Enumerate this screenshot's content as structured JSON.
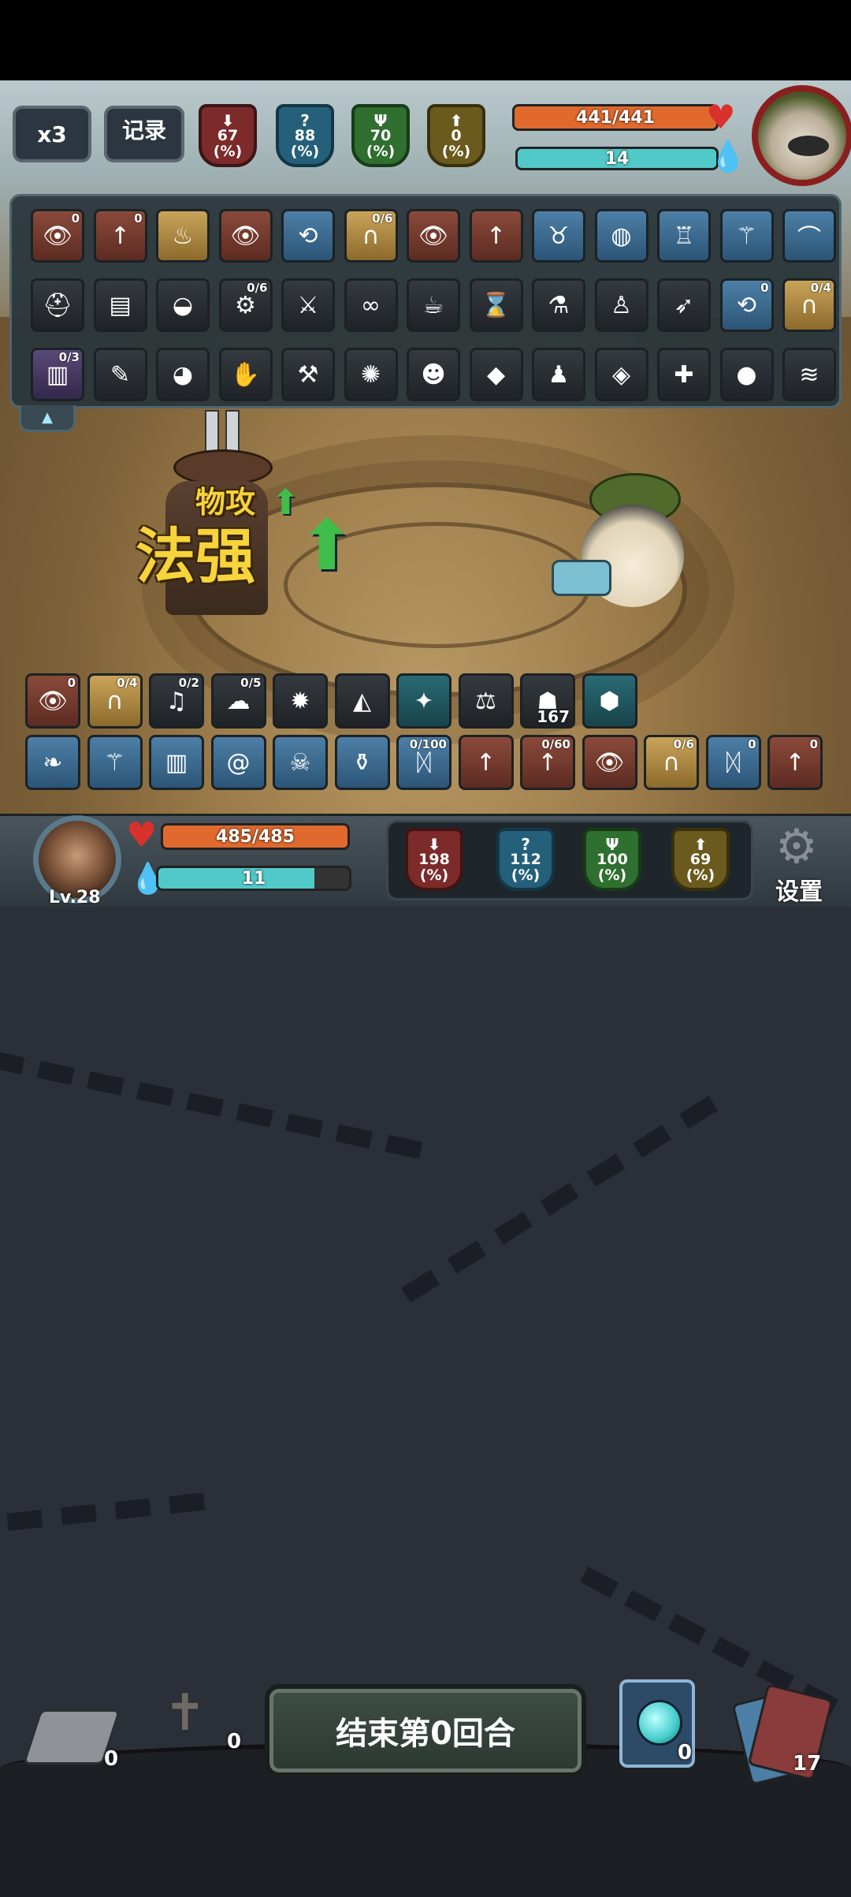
{
  "speed_label": "x3",
  "record_label": "记录",
  "enemy_stats": [
    {
      "value": "67",
      "unit": "(%)",
      "color": "red",
      "icon": "down-arrow-icon"
    },
    {
      "value": "88",
      "unit": "(%)",
      "color": "blue",
      "icon": "question-icon"
    },
    {
      "value": "70",
      "unit": "(%)",
      "color": "green",
      "icon": "trident-icon"
    },
    {
      "value": "0",
      "unit": "(%)",
      "color": "gold",
      "icon": "up-arrow-icon"
    }
  ],
  "enemy_hp": {
    "text": "441/441",
    "fraction": 1.0,
    "color": "#e06a2e"
  },
  "enemy_mana": {
    "text": "14",
    "fraction": 1.0,
    "color": "#52c9c9"
  },
  "enemy_items_row1": [
    {
      "tile": "brown",
      "icon": "eye-icon",
      "count": "0"
    },
    {
      "tile": "brown",
      "icon": "arrow-up-icon",
      "count": "0"
    },
    {
      "tile": "gold",
      "icon": "flame-icon",
      "count": ""
    },
    {
      "tile": "brown",
      "icon": "eye-icon",
      "count": ""
    },
    {
      "tile": "blue",
      "icon": "cycle-icon",
      "count": ""
    },
    {
      "tile": "gold",
      "icon": "horseshoe-icon",
      "count": "0/6"
    },
    {
      "tile": "brown",
      "icon": "eye-icon",
      "count": ""
    },
    {
      "tile": "brown",
      "icon": "arrow-up-icon",
      "count": ""
    },
    {
      "tile": "blue",
      "icon": "bull-icon",
      "count": ""
    },
    {
      "tile": "blue",
      "icon": "orb-icon",
      "count": ""
    },
    {
      "tile": "blue",
      "icon": "pig-icon",
      "count": ""
    },
    {
      "tile": "blue",
      "icon": "wand-icon",
      "count": ""
    },
    {
      "tile": "blue",
      "icon": "claw-icon",
      "count": ""
    }
  ],
  "enemy_items_row2": [
    {
      "tile": "dark",
      "icon": "helmet-icon",
      "count": ""
    },
    {
      "tile": "dark",
      "icon": "book-icon",
      "count": ""
    },
    {
      "tile": "dark",
      "icon": "bag-icon",
      "count": ""
    },
    {
      "tile": "dark",
      "icon": "robot-icon",
      "count": "0/6"
    },
    {
      "tile": "dark",
      "icon": "sword-icon",
      "count": ""
    },
    {
      "tile": "dark",
      "icon": "glasses-icon",
      "count": ""
    },
    {
      "tile": "dark",
      "icon": "teacup-icon",
      "count": ""
    },
    {
      "tile": "dark",
      "icon": "hourglass-icon",
      "count": ""
    },
    {
      "tile": "dark",
      "icon": "potion-icon",
      "count": ""
    },
    {
      "tile": "dark",
      "icon": "figure-icon",
      "count": ""
    },
    {
      "tile": "dark",
      "icon": "rocket-icon",
      "count": ""
    },
    {
      "tile": "blue",
      "icon": "cycle-icon",
      "count": "0"
    },
    {
      "tile": "gold",
      "icon": "horseshoe-icon",
      "count": "0/4"
    }
  ],
  "enemy_items_row3": [
    {
      "tile": "purple",
      "icon": "tome-icon",
      "count": "0/3"
    },
    {
      "tile": "dark",
      "icon": "bone-icon",
      "count": ""
    },
    {
      "tile": "dark",
      "icon": "owl-icon",
      "count": ""
    },
    {
      "tile": "dark",
      "icon": "glove-icon",
      "count": ""
    },
    {
      "tile": "dark",
      "icon": "axe-icon",
      "count": ""
    },
    {
      "tile": "dark",
      "icon": "beetle-icon",
      "count": ""
    },
    {
      "tile": "dark",
      "icon": "demon-icon",
      "count": ""
    },
    {
      "tile": "dark",
      "icon": "slime-icon",
      "count": ""
    },
    {
      "tile": "dark",
      "icon": "doll-icon",
      "count": ""
    },
    {
      "tile": "dark",
      "icon": "gem-icon",
      "count": ""
    },
    {
      "tile": "dark",
      "icon": "crossbow-icon",
      "count": ""
    },
    {
      "tile": "dark",
      "icon": "bomb-icon",
      "count": ""
    },
    {
      "tile": "dark",
      "icon": "wings-icon",
      "count": ""
    }
  ],
  "floating_text": {
    "small": "物攻",
    "big": "法强"
  },
  "player_items_row1": [
    {
      "tile": "brown",
      "icon": "eye-icon",
      "count": "0",
      "bottom": ""
    },
    {
      "tile": "gold",
      "icon": "horseshoe-icon",
      "count": "0/4",
      "bottom": ""
    },
    {
      "tile": "dark",
      "icon": "bell-icon",
      "count": "0/2",
      "bottom": ""
    },
    {
      "tile": "dark",
      "icon": "cloud-icon",
      "count": "0/5",
      "bottom": ""
    },
    {
      "tile": "dark",
      "icon": "fire-icon",
      "count": "",
      "bottom": ""
    },
    {
      "tile": "dark",
      "icon": "crystal-icon",
      "count": "",
      "bottom": ""
    },
    {
      "tile": "teal",
      "icon": "magic-orb-icon",
      "count": "",
      "bottom": ""
    },
    {
      "tile": "dark",
      "icon": "scales-icon",
      "count": "",
      "bottom": ""
    },
    {
      "tile": "dark",
      "icon": "muscle-icon",
      "count": "",
      "bottom": "167"
    },
    {
      "tile": "teal",
      "icon": "hex-gem-icon",
      "count": "",
      "bottom": ""
    }
  ],
  "player_items_row2": [
    {
      "tile": "blue",
      "icon": "leaf-icon",
      "count": "",
      "bottom": ""
    },
    {
      "tile": "blue",
      "icon": "wand-icon",
      "count": "",
      "bottom": ""
    },
    {
      "tile": "blue",
      "icon": "piano-icon",
      "count": "",
      "bottom": ""
    },
    {
      "tile": "blue",
      "icon": "swirl-icon",
      "count": "",
      "bottom": ""
    },
    {
      "tile": "blue",
      "icon": "skull-icon",
      "count": "",
      "bottom": ""
    },
    {
      "tile": "blue",
      "icon": "flask-icon",
      "count": "",
      "bottom": ""
    },
    {
      "tile": "blue",
      "icon": "rune-icon",
      "count": "0/100",
      "bottom": ""
    },
    {
      "tile": "brown",
      "icon": "arrow-up-icon",
      "count": "",
      "bottom": ""
    },
    {
      "tile": "brown",
      "icon": "arrow-up-icon",
      "count": "0/60",
      "bottom": ""
    },
    {
      "tile": "brown",
      "icon": "eye-icon",
      "count": "",
      "bottom": ""
    },
    {
      "tile": "gold",
      "icon": "horseshoe-icon",
      "count": "0/6",
      "bottom": ""
    },
    {
      "tile": "blue",
      "icon": "rune-icon",
      "count": "0",
      "bottom": ""
    },
    {
      "tile": "brown",
      "icon": "arrow-up-icon",
      "count": "0",
      "bottom": ""
    }
  ],
  "player": {
    "level": "Lv.28",
    "hp": {
      "text": "485/485",
      "fraction": 1.0,
      "color": "#e06a2e"
    },
    "mana": {
      "text": "11",
      "fraction": 0.82,
      "color": "#52c9c9"
    }
  },
  "player_stats": [
    {
      "value": "198",
      "unit": "(%)",
      "color": "red",
      "icon": "down-arrow-icon"
    },
    {
      "value": "112",
      "unit": "(%)",
      "color": "blue",
      "icon": "question-icon"
    },
    {
      "value": "100",
      "unit": "(%)",
      "color": "green",
      "icon": "trident-icon"
    },
    {
      "value": "69",
      "unit": "(%)",
      "color": "gold",
      "icon": "up-arrow-icon"
    }
  ],
  "settings_label": "设置",
  "end_turn_label": "结束第0回合",
  "piles": {
    "discard": "0",
    "graveyard": "0",
    "potion": "0",
    "draw": "17"
  }
}
